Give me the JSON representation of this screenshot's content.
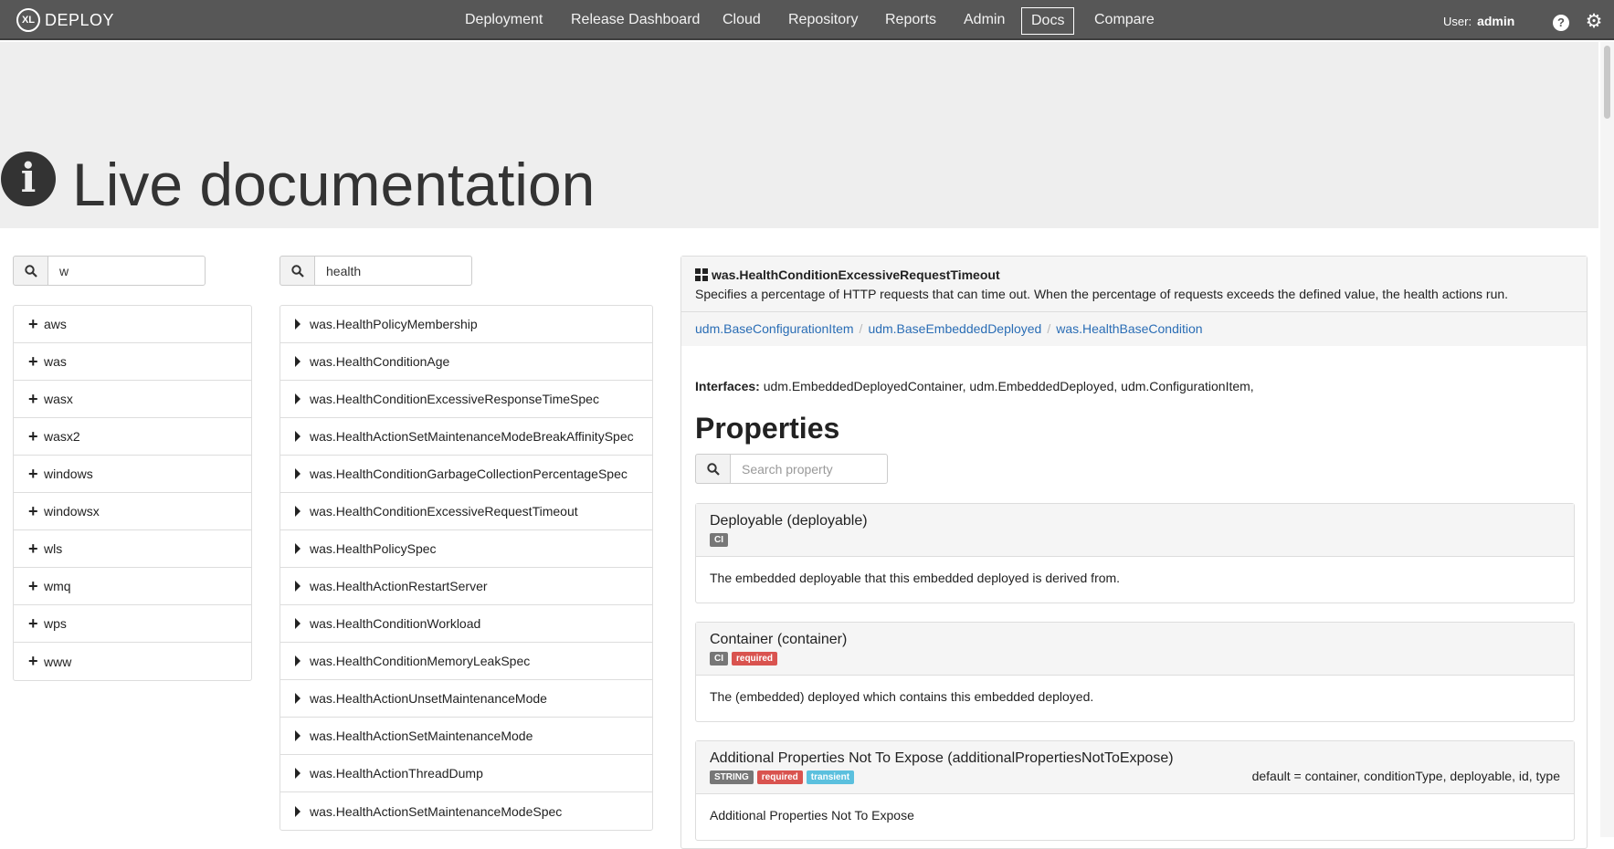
{
  "navbar": {
    "logo_mark": "XL",
    "logo_text": "DEPLOY",
    "items": [
      {
        "label": "Deployment"
      },
      {
        "label": "Release Dashboard"
      },
      {
        "label": "Cloud"
      },
      {
        "label": "Repository"
      },
      {
        "label": "Reports"
      },
      {
        "label": "Admin"
      },
      {
        "label": "Docs",
        "active": true
      },
      {
        "label": "Compare"
      }
    ],
    "user_prefix": "User:",
    "user_name": "admin",
    "help_glyph": "?",
    "icons": [
      "question-icon",
      "gear-icon"
    ]
  },
  "header": {
    "title": "Live documentation",
    "icon": "info-circle-icon"
  },
  "type_search": {
    "value": "w"
  },
  "type_list": [
    {
      "label": "aws"
    },
    {
      "label": "was"
    },
    {
      "label": "wasx"
    },
    {
      "label": "wasx2"
    },
    {
      "label": "windows"
    },
    {
      "label": "windowsx"
    },
    {
      "label": "wls"
    },
    {
      "label": "wmq"
    },
    {
      "label": "wps"
    },
    {
      "label": "www"
    }
  ],
  "ci_search": {
    "value": "health"
  },
  "ci_list": [
    {
      "label": "was.HealthPolicyMembership"
    },
    {
      "label": "was.HealthConditionAge"
    },
    {
      "label": "was.HealthConditionExcessiveResponseTimeSpec"
    },
    {
      "label": "was.HealthActionSetMaintenanceModeBreakAffinitySpec"
    },
    {
      "label": "was.HealthConditionGarbageCollectionPercentageSpec"
    },
    {
      "label": "was.HealthConditionExcessiveRequestTimeout"
    },
    {
      "label": "was.HealthPolicySpec"
    },
    {
      "label": "was.HealthActionRestartServer"
    },
    {
      "label": "was.HealthConditionWorkload"
    },
    {
      "label": "was.HealthConditionMemoryLeakSpec"
    },
    {
      "label": "was.HealthActionUnsetMaintenanceMode"
    },
    {
      "label": "was.HealthActionSetMaintenanceMode"
    },
    {
      "label": "was.HealthActionThreadDump"
    },
    {
      "label": "was.HealthActionSetMaintenanceModeSpec"
    }
  ],
  "detail": {
    "ci_name": "was.HealthConditionExcessiveRequestTimeout",
    "ci_description": "Specifies a percentage of HTTP requests that can time out. When the percentage of requests exceeds the defined value, the health actions run.",
    "breadcrumb": [
      "udm.BaseConfigurationItem",
      "udm.BaseEmbeddedDeployed",
      "was.HealthBaseCondition"
    ],
    "breadcrumb_separator": "/",
    "interfaces_label": "Interfaces:",
    "interfaces_value": "udm.EmbeddedDeployedContainer, udm.EmbeddedDeployed, udm.ConfigurationItem,",
    "properties_title": "Properties",
    "property_search_placeholder": "Search property",
    "properties": [
      {
        "name": "Deployable (deployable)",
        "badges": [
          {
            "text": "CI",
            "color": "#777777"
          }
        ],
        "default": "",
        "description": "The embedded deployable that this embedded deployed is derived from."
      },
      {
        "name": "Container (container)",
        "badges": [
          {
            "text": "CI",
            "color": "#777777"
          },
          {
            "text": "required",
            "color": "#d9534f"
          }
        ],
        "default": "",
        "description": "The (embedded) deployed which contains this embedded deployed."
      },
      {
        "name": "Additional Properties Not To Expose (additionalPropertiesNotToExpose)",
        "badges": [
          {
            "text": "STRING",
            "color": "#777777"
          },
          {
            "text": "required",
            "color": "#d9534f"
          },
          {
            "text": "transient",
            "color": "#5bc0de"
          }
        ],
        "default": "default = container, conditionType, deployable, id, type",
        "description": "Additional Properties Not To Expose"
      }
    ]
  },
  "colors": {
    "navbar": "#575757",
    "jumbotron": "#eeeeee",
    "link": "#2a6db5"
  }
}
